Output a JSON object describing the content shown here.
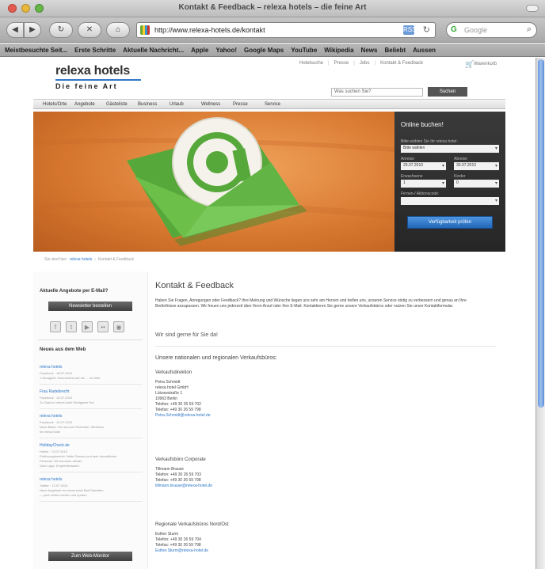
{
  "browser": {
    "window_title": "Kontakt & Feedback – relexa hotels – die feine Art",
    "url": "http://www.relexa-hotels.de/kontakt",
    "search_placeholder": "Google",
    "nav_buttons": {
      "back": "◀",
      "forward": "▶",
      "reload": "↻",
      "stop": "✕",
      "home": "⌂"
    },
    "bookmarks": [
      "Meistbesuchte Seit...",
      "Erste Schritte",
      "Aktuelle Nachricht...",
      "Apple",
      "Yahoo!",
      "Google Maps",
      "YouTube",
      "Wikipedia",
      "News",
      "Beliebt",
      "Aussen"
    ]
  },
  "site": {
    "logo_name": "relexa hotels",
    "logo_tagline": "Die feine Art",
    "topnav": [
      "Hotelsuche",
      "Presse",
      "Jobs",
      "Kontakt & Feedback"
    ],
    "cart_label": "Warenkorb",
    "search_placeholder": "Was suchen Sie?",
    "search_button": "Suchen",
    "mainnav": [
      "Hotels/Orte",
      "Angebote",
      "Gästeliste",
      "Business",
      "Urlaub",
      "Wellness",
      "Presse",
      "Service"
    ]
  },
  "booking": {
    "title": "Online buchen!",
    "hotel_label": "Bitte wählen Sie Ihr relexa hotel:",
    "hotel_value": "Bitte wählen",
    "arrival_label": "Anreise",
    "arrival_value": "29.07.2010",
    "departure_label": "Abreise",
    "departure_value": "30.07.2010",
    "adults_label": "Erwachsene",
    "adults_value": "1",
    "children_label": "Kinder",
    "children_value": "0",
    "promo_label": "Firmen-/ Aktionscode:",
    "button": "Verfügbarkeit prüfen"
  },
  "breadcrumb": [
    "Sie sind hier:",
    "relexa hotels",
    "›",
    "Kontakt & Feedback"
  ],
  "sidebar": {
    "newsletter_title": "Aktuelle Angebote per E-Mail?",
    "newsletter_button": "Newsletter bestellen",
    "social": [
      {
        "icon": "facebook-icon",
        "glyph": "f"
      },
      {
        "icon": "twitter-icon",
        "glyph": "t"
      },
      {
        "icon": "youtube-icon",
        "glyph": "▶"
      },
      {
        "icon": "flickr-icon",
        "glyph": "••"
      },
      {
        "icon": "rss-icon",
        "glyph": "◉"
      }
    ],
    "web_title": "Neues aus dem Web",
    "web_items": [
      {
        "title": "relexa hotels",
        "lines": [
          "Facebook · 18.07.2010",
          "1 Neuigkeit: Sommerfest auf der ... im Web"
        ]
      },
      {
        "title": "Frau Radebrecht",
        "lines": [
          "Facebook · 15.07.2010",
          "Zu Gast im relexa hotel Stuttgarter Hof"
        ]
      },
      {
        "title": "relexa hotels",
        "lines": [
          "Facebook · 14.07.2010",
          "Neue Bilder: Wir sind am Rheinufer: Wellness",
          "im relexa hotel"
        ]
      },
      {
        "title": "HolidayCheck.de",
        "lines": [
          "Hotels · 13.07.2010",
          "Erfahrungsbericht: Nette Zimmer und sehr freundliches",
          "Personal. Wir kommen wieder",
          "Gute Lage. Empfehlenswert."
        ]
      },
      {
        "title": "relexa hotels",
        "lines": [
          "Twitter · 12.07.2010",
          "Neue Angebote im relexa hotel Bad Salzuflen",
          "— jetzt online buchen und sparen"
        ]
      }
    ],
    "more_button": "Zum Web-Monitor"
  },
  "content": {
    "title": "Kontakt & Feedback",
    "intro": "Haben Sie Fragen, Anregungen oder Feedback? Ihre Meinung und Wünsche liegen uns sehr am Herzen und helfen uns, unseren Service stetig zu verbessern und genau an Ihre Bedürfnisse anzupassen. Wir freuen uns jederzeit über Ihren Anruf oder Ihre E-Mail. Kontaktieren Sie gerne unsere Verkaufsbüros oder nutzen Sie unser Kontaktformular.",
    "intro_sub": "Wir sind gerne für Sie da!",
    "sales_heading": "Unsere nationalen und regionalen Verkaufsbüros:",
    "offices": [
      {
        "title": "Verkaufsdirektion",
        "lines": [
          "Petra Schmidt",
          "relexa hotel GmbH",
          "Lützowstraße 1",
          "10963 Berlin",
          "Telefon: +49 30 26 59 702",
          "Telefax: +49 30 26 59 798"
        ],
        "email": "Petra.Schmidt@relexa-hotel.de"
      },
      {
        "title": "Verkaufsbüro Corporate",
        "lines": [
          "Tillmann Brause",
          "Telefon: +49 30 26 59 703",
          "Telefax: +49 30 26 59 798"
        ],
        "email": "tillmann.brause@relexa-hotel.de"
      },
      {
        "title": "Regionale Verkaufsbüros Nord/Ost",
        "lines": [
          "Esther Sturm",
          "Telefon: +49 30 26 59 704",
          "Telefax: +49 30 26 59 798"
        ],
        "email": "Esther.Sturm@relexa-hotel.de"
      }
    ]
  },
  "colors": {
    "accent": "#2e77c8",
    "hero_orange": "#d6762e",
    "envelope_green": "#6cc04a"
  }
}
